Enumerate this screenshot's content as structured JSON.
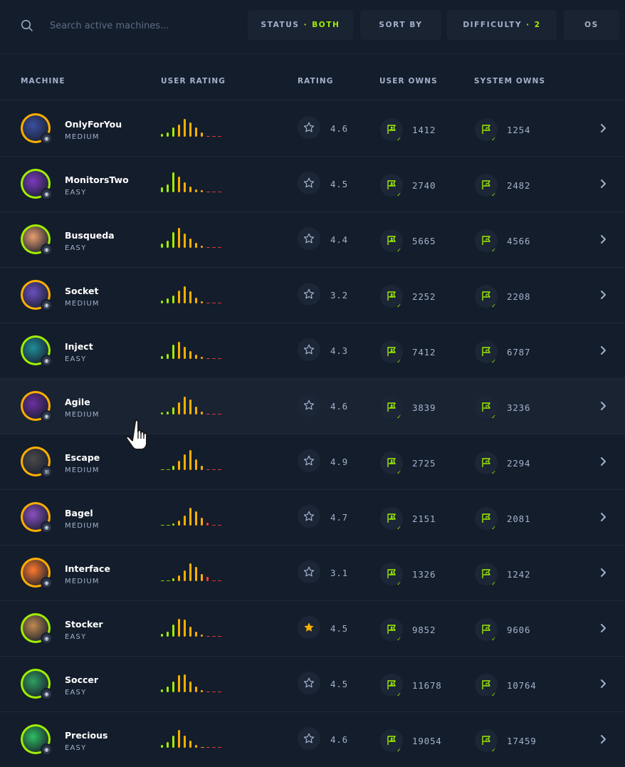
{
  "search": {
    "placeholder": "Search active machines..."
  },
  "filters": {
    "status_label": "STATUS",
    "status_value": "BOTH",
    "sort_label": "SORT BY",
    "difficulty_label": "DIFFICULTY",
    "difficulty_value": "2",
    "os_label": "OS"
  },
  "headers": {
    "machine": "MACHINE",
    "user_rating": "USER RATING",
    "rating": "RATING",
    "user_owns": "USER OWNS",
    "system_owns": "SYSTEM OWNS"
  },
  "colors": {
    "background": "#141d2b",
    "accent": "#9fef00",
    "text_muted": "#a4b1cd",
    "orange": "#ffaf00",
    "red": "#ff3e3e"
  },
  "machines": [
    {
      "name": "OnlyForYou",
      "difficulty": "MEDIUM",
      "rating": "4.6",
      "user_owns": "1412",
      "system_owns": "1254",
      "os": "linux",
      "starred": false,
      "avatar_colors": [
        "#ffaf00",
        "#3a4fa0"
      ]
    },
    {
      "name": "MonitorsTwo",
      "difficulty": "EASY",
      "rating": "4.5",
      "user_owns": "2740",
      "system_owns": "2482",
      "os": "linux",
      "starred": false,
      "avatar_colors": [
        "#9fef00",
        "#7a3bbf"
      ]
    },
    {
      "name": "Busqueda",
      "difficulty": "EASY",
      "rating": "4.4",
      "user_owns": "5665",
      "system_owns": "4566",
      "os": "linux",
      "starred": false,
      "avatar_colors": [
        "#9fef00",
        "#e8a070"
      ]
    },
    {
      "name": "Socket",
      "difficulty": "MEDIUM",
      "rating": "3.2",
      "user_owns": "2252",
      "system_owns": "2208",
      "os": "linux",
      "starred": false,
      "avatar_colors": [
        "#ffaf00",
        "#6a4fc0"
      ]
    },
    {
      "name": "Inject",
      "difficulty": "EASY",
      "rating": "4.3",
      "user_owns": "7412",
      "system_owns": "6787",
      "os": "linux",
      "starred": false,
      "avatar_colors": [
        "#9fef00",
        "#1e8f9a"
      ]
    },
    {
      "name": "Agile",
      "difficulty": "MEDIUM",
      "rating": "4.6",
      "user_owns": "3839",
      "system_owns": "3236",
      "os": "linux",
      "starred": false,
      "avatar_colors": [
        "#ffaf00",
        "#6b2fa0"
      ]
    },
    {
      "name": "Escape",
      "difficulty": "MEDIUM",
      "rating": "4.9",
      "user_owns": "2725",
      "system_owns": "2294",
      "os": "windows",
      "starred": false,
      "avatar_colors": [
        "#ffaf00",
        "#4a4a4a"
      ]
    },
    {
      "name": "Bagel",
      "difficulty": "MEDIUM",
      "rating": "4.7",
      "user_owns": "2151",
      "system_owns": "2081",
      "os": "linux",
      "starred": false,
      "avatar_colors": [
        "#ffaf00",
        "#8a4fc0"
      ]
    },
    {
      "name": "Interface",
      "difficulty": "MEDIUM",
      "rating": "3.1",
      "user_owns": "1326",
      "system_owns": "1242",
      "os": "linux",
      "starred": false,
      "avatar_colors": [
        "#ffaf00",
        "#ff7a2e"
      ]
    },
    {
      "name": "Stocker",
      "difficulty": "EASY",
      "rating": "4.5",
      "user_owns": "9852",
      "system_owns": "9606",
      "os": "linux",
      "starred": true,
      "avatar_colors": [
        "#9fef00",
        "#c08a50"
      ]
    },
    {
      "name": "Soccer",
      "difficulty": "EASY",
      "rating": "4.5",
      "user_owns": "11678",
      "system_owns": "10764",
      "os": "linux",
      "starred": false,
      "avatar_colors": [
        "#9fef00",
        "#2fa060"
      ]
    },
    {
      "name": "Precious",
      "difficulty": "EASY",
      "rating": "4.6",
      "user_owns": "19054",
      "system_owns": "17459",
      "os": "linux",
      "starred": false,
      "avatar_colors": [
        "#9fef00",
        "#2fbf60"
      ]
    }
  ],
  "user_rating_bars": [
    [
      0.15,
      0.2,
      0.45,
      0.6,
      0.9,
      0.7,
      0.45,
      0.2,
      0.05,
      0.05,
      0.05
    ],
    [
      0.25,
      0.4,
      1.0,
      0.8,
      0.5,
      0.3,
      0.15,
      0.1,
      0.05,
      0.05,
      0.05
    ],
    [
      0.2,
      0.35,
      0.8,
      1.0,
      0.7,
      0.45,
      0.25,
      0.1,
      0.05,
      0.05,
      0.05
    ],
    [
      0.15,
      0.25,
      0.4,
      0.65,
      0.85,
      0.6,
      0.3,
      0.1,
      0.05,
      0.05,
      0.05
    ],
    [
      0.15,
      0.25,
      0.7,
      0.85,
      0.6,
      0.4,
      0.2,
      0.1,
      0.05,
      0.05,
      0.05
    ],
    [
      0.1,
      0.15,
      0.35,
      0.6,
      0.9,
      0.75,
      0.4,
      0.15,
      0.05,
      0.05,
      0.05
    ],
    [
      0.05,
      0.05,
      0.2,
      0.45,
      0.8,
      1.0,
      0.55,
      0.2,
      0.05,
      0.05,
      0.05
    ],
    [
      0.05,
      0.05,
      0.1,
      0.25,
      0.5,
      0.9,
      0.7,
      0.4,
      0.15,
      0.05,
      0.05
    ],
    [
      0.05,
      0.05,
      0.15,
      0.3,
      0.55,
      0.9,
      0.7,
      0.35,
      0.2,
      0.05,
      0.05
    ],
    [
      0.15,
      0.25,
      0.6,
      0.9,
      0.85,
      0.5,
      0.25,
      0.1,
      0.05,
      0.05,
      0.05
    ],
    [
      0.15,
      0.3,
      0.55,
      0.85,
      0.9,
      0.55,
      0.3,
      0.1,
      0.05,
      0.05,
      0.05
    ],
    [
      0.15,
      0.3,
      0.6,
      0.9,
      0.6,
      0.35,
      0.15,
      0.05,
      0.05,
      0.05,
      0.05
    ]
  ]
}
